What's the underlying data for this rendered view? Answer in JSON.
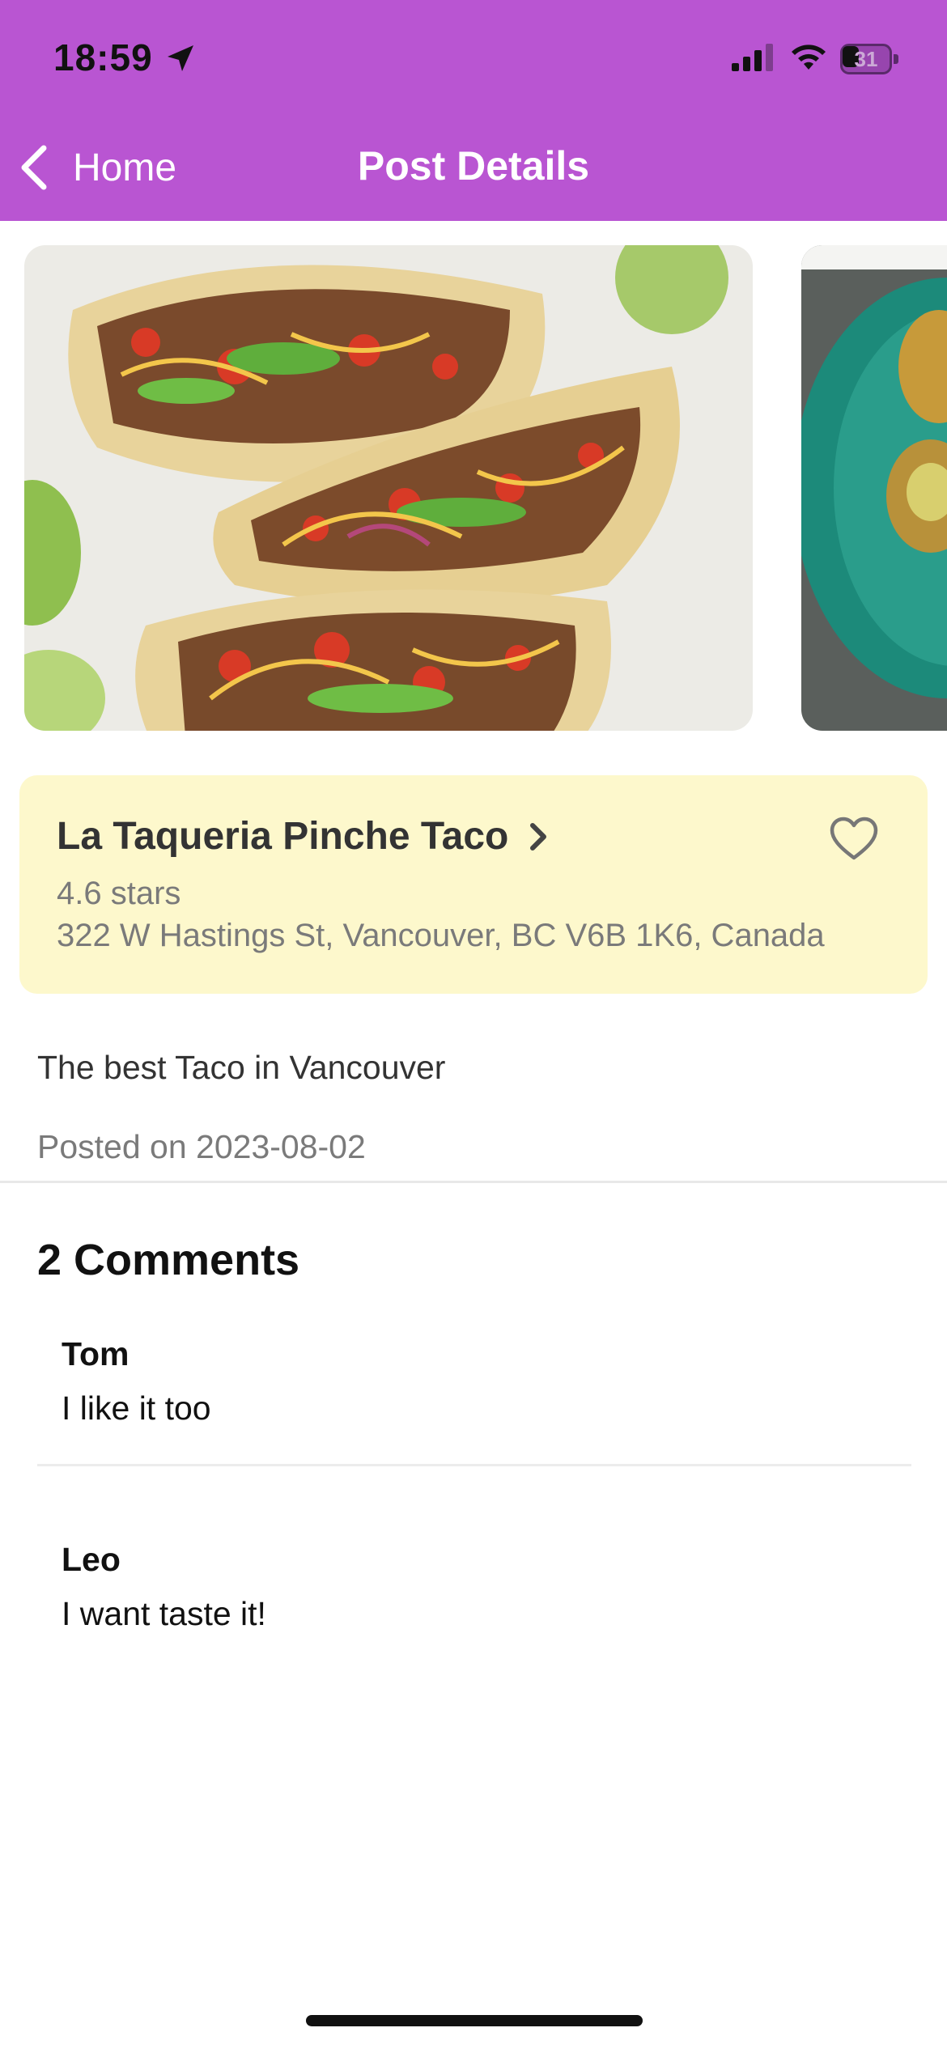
{
  "status_bar": {
    "time": "18:59",
    "battery": "31",
    "icons": [
      "location-arrow-icon",
      "cellular-signal-icon",
      "wifi-icon",
      "battery-icon"
    ]
  },
  "nav": {
    "back_label": "Home",
    "title": "Post Details",
    "color": "#b955d2"
  },
  "carousel": {
    "images": [
      "tacos-photo",
      "jalapeno-poppers-photo"
    ]
  },
  "restaurant": {
    "name": "La Taqueria Pinche Taco",
    "rating": "4.6 stars",
    "address": "322 W Hastings St, Vancouver, BC V6B 1K6, Canada",
    "card_color": "#fdf8cc"
  },
  "post": {
    "text": "The best Taco in Vancouver",
    "date": "Posted on 2023-08-02"
  },
  "comments": {
    "heading": "2 Comments",
    "items": [
      {
        "author": "Tom",
        "text": "I like it too"
      },
      {
        "author": "Leo",
        "text": "I want taste it!"
      }
    ]
  }
}
